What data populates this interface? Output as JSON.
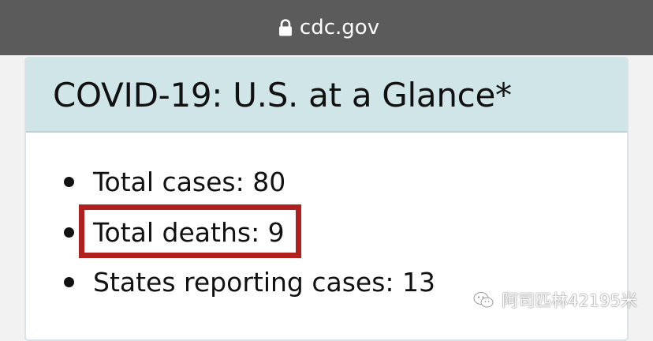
{
  "browser": {
    "url": "cdc.gov",
    "lock_icon": "lock-icon"
  },
  "card": {
    "title": "COVID-19: U.S. at a Glance*",
    "stats": [
      {
        "text": "Total cases: 80"
      },
      {
        "text": "Total deaths: 9",
        "highlighted": true
      },
      {
        "text": "States reporting cases: 13"
      }
    ]
  },
  "watermark": {
    "icon": "wechat-icon",
    "text": "阿司匹林42195米"
  },
  "colors": {
    "address_bar": "#5b5b5b",
    "header_bg": "#cfe5e8",
    "highlight_border": "#b0201f"
  }
}
